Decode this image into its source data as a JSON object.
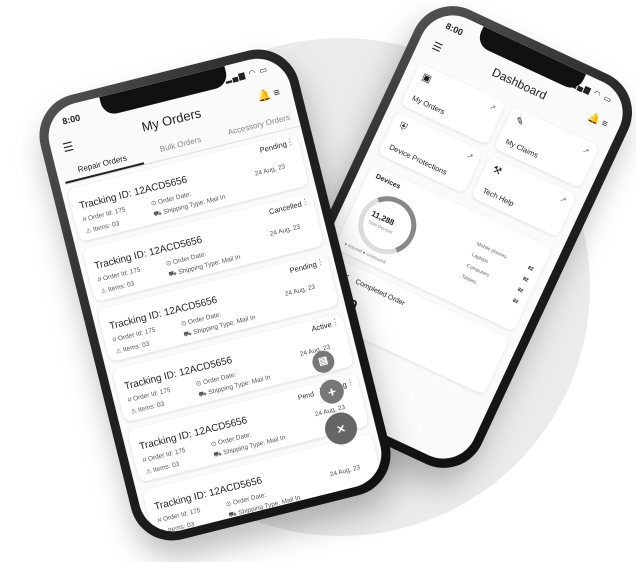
{
  "back_phone": {
    "status_time": "8:00",
    "title": "Dashboard",
    "menu_icon": "hamburger-menu-icon",
    "tiles": [
      {
        "label": "My Orders",
        "icon": "orders-icon"
      },
      {
        "label": "My Claims",
        "icon": "claims-icon"
      },
      {
        "label": "Device Protections",
        "icon": "protection-icon"
      },
      {
        "label": "Tech Help",
        "icon": "tech-help-icon"
      }
    ],
    "devices": {
      "title": "Devices",
      "total": "11,288",
      "total_label": "Total Devices",
      "legend": "● Insured   ● Uninsured",
      "list": [
        {
          "label": "Mobile phones",
          "value": "82"
        },
        {
          "label": "Laptops",
          "value": "82"
        },
        {
          "label": "Computers",
          "value": "82"
        },
        {
          "label": "Tablets",
          "value": "82"
        }
      ]
    },
    "completed": {
      "label": "Completed Order",
      "value": "4,250"
    }
  },
  "front_phone": {
    "status_time": "8:00",
    "title": "My Orders",
    "tabs": [
      "Repair Orders",
      "Bulk Orders",
      "Accessory Orders"
    ],
    "orders": [
      {
        "tracking": "Tracking ID: 12ACD5656",
        "status": "Pending",
        "order_id": "Order Id:  175",
        "items": "Items:  03",
        "date_label": "Order Date:",
        "date": "24 Aug, 23",
        "shipping": "Shipping Type:  Mail In"
      },
      {
        "tracking": "Tracking ID: 12ACD5656",
        "status": "Cancelled",
        "order_id": "Order Id:  175",
        "items": "Items:  03",
        "date_label": "Order Date:",
        "date": "24 Aug, 23",
        "shipping": "Shipping Type:  Mail In"
      },
      {
        "tracking": "Tracking ID: 12ACD5656",
        "status": "Pending",
        "order_id": "Order Id:  175",
        "items": "Items:  03",
        "date_label": "Order Date:",
        "date": "24 Aug, 23",
        "shipping": "Shipping Type:  Mail In"
      },
      {
        "tracking": "Tracking ID: 12ACD5656",
        "status": "Active",
        "order_id": "Order Id:  175",
        "items": "Items:  03",
        "date_label": "Order Date:",
        "date": "24 Aug, 23",
        "shipping": "Shipping Type:  Mail In"
      },
      {
        "tracking": "Tracking ID: 12ACD5656",
        "status": "Pending",
        "order_id": "Order Id:  175",
        "items": "Items:  03",
        "date_label": "Order Date:",
        "date": "24 Aug, 23",
        "shipping": "Shipping Type:  Mail In"
      },
      {
        "tracking": "Tracking ID: 12ACD5656",
        "status": "",
        "order_id": "Order Id:  175",
        "items": "Items:  03",
        "date_label": "Order Date:",
        "date": "24 Aug, 23",
        "shipping": "Shipping Type:  Mail In"
      }
    ],
    "peek_text": "Pend",
    "fab_add": "+",
    "fab_close": "×"
  }
}
